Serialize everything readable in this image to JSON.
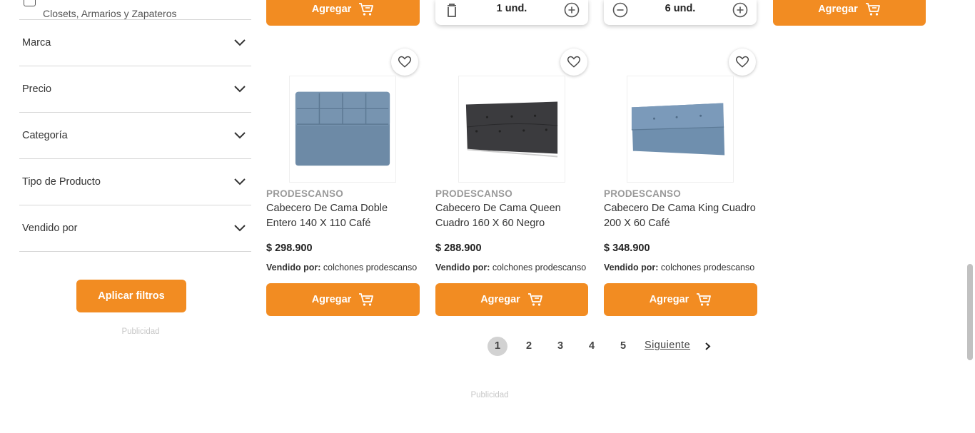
{
  "sidebar": {
    "partial_category_label": "Closets, Armarios y Zapateros",
    "filters": [
      {
        "label": "Marca"
      },
      {
        "label": "Precio"
      },
      {
        "label": "Categoría"
      },
      {
        "label": "Tipo de Producto"
      },
      {
        "label": "Vendido por"
      }
    ],
    "apply_button": "Aplicar filtros",
    "advertising_label": "Publicidad"
  },
  "top_row": {
    "add_label": "Agregar",
    "quantity_1": "1 und.",
    "quantity_2": "6 und."
  },
  "products": [
    {
      "brand": "PRODESCANSO",
      "name": "Cabecero De Cama Doble Entero 140 X 110 Café",
      "price": "$ 298.900",
      "seller_prefix": "Vendido por:",
      "seller": "colchones prodescanso",
      "add_label": "Agregar",
      "image_color": "light-blue"
    },
    {
      "brand": "PRODESCANSO",
      "name": "Cabecero De Cama Queen Cuadro 160 X 60 Negro",
      "price": "$ 288.900",
      "seller_prefix": "Vendido por:",
      "seller": "colchones prodescanso",
      "add_label": "Agregar",
      "image_color": "charcoal"
    },
    {
      "brand": "PRODESCANSO",
      "name": "Cabecero De Cama King Cuadro 200 X 60 Café",
      "price": "$ 348.900",
      "seller_prefix": "Vendido por:",
      "seller": "colchones prodescanso",
      "add_label": "Agregar",
      "image_color": "light-blue"
    }
  ],
  "pagination": {
    "pages": [
      "1",
      "2",
      "3",
      "4",
      "5"
    ],
    "current": "1",
    "next_label": "Siguiente"
  },
  "footer": {
    "advertising_label": "Publicidad"
  },
  "colors": {
    "accent": "#f28c22",
    "divider": "#d6d6d6",
    "active_page": "#d2d2d2"
  },
  "icons": [
    "chevron-down-icon",
    "heart-icon",
    "cart-icon",
    "trash-icon",
    "plus-circle-icon",
    "minus-circle-icon",
    "chevron-right-icon"
  ]
}
